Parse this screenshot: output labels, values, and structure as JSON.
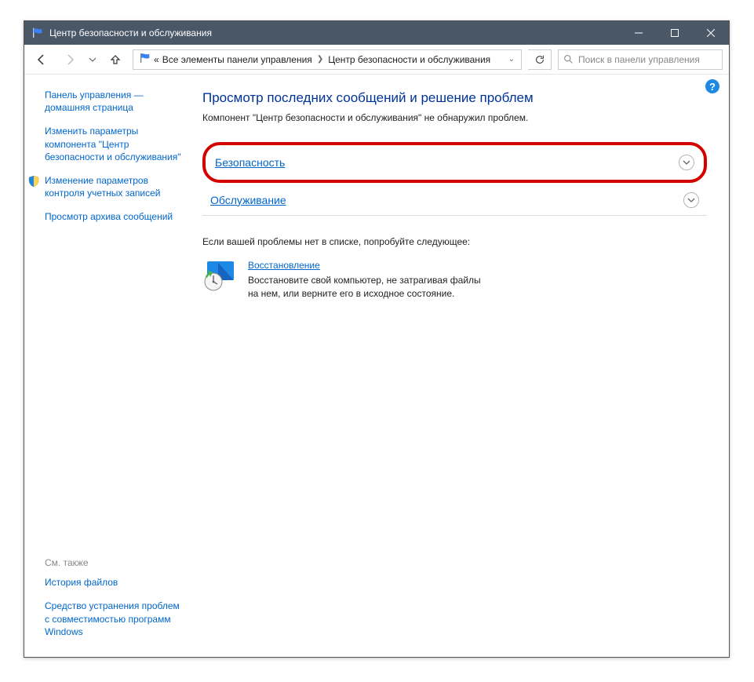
{
  "window": {
    "title": "Центр безопасности и обслуживания"
  },
  "breadcrumb": {
    "prefix": "«",
    "item1": "Все элементы панели управления",
    "item2": "Центр безопасности и обслуживания"
  },
  "search": {
    "placeholder": "Поиск в панели управления"
  },
  "sidebar": {
    "items": [
      {
        "label": "Панель управления — домашняя страница"
      },
      {
        "label": "Изменить параметры компонента \"Центр безопасности и обслуживания\""
      },
      {
        "label": "Изменение параметров контроля учетных записей",
        "hasShield": true
      },
      {
        "label": "Просмотр архива сообщений"
      }
    ],
    "seeAlso": "См. также",
    "bottom": [
      {
        "label": "История файлов"
      },
      {
        "label": "Средство устранения проблем с совместимостью программ Windows"
      }
    ]
  },
  "main": {
    "heading": "Просмотр последних сообщений и решение проблем",
    "subtext": "Компонент \"Центр безопасности и обслуживания\" не обнаружил проблем.",
    "security": "Безопасность",
    "maintenance": "Обслуживание",
    "notFound": "Если вашей проблемы нет в списке, попробуйте следующее:",
    "recovery": {
      "title": "Восстановление",
      "desc": "Восстановите свой компьютер, не затрагивая файлы на нем, или верните его в исходное состояние."
    }
  }
}
